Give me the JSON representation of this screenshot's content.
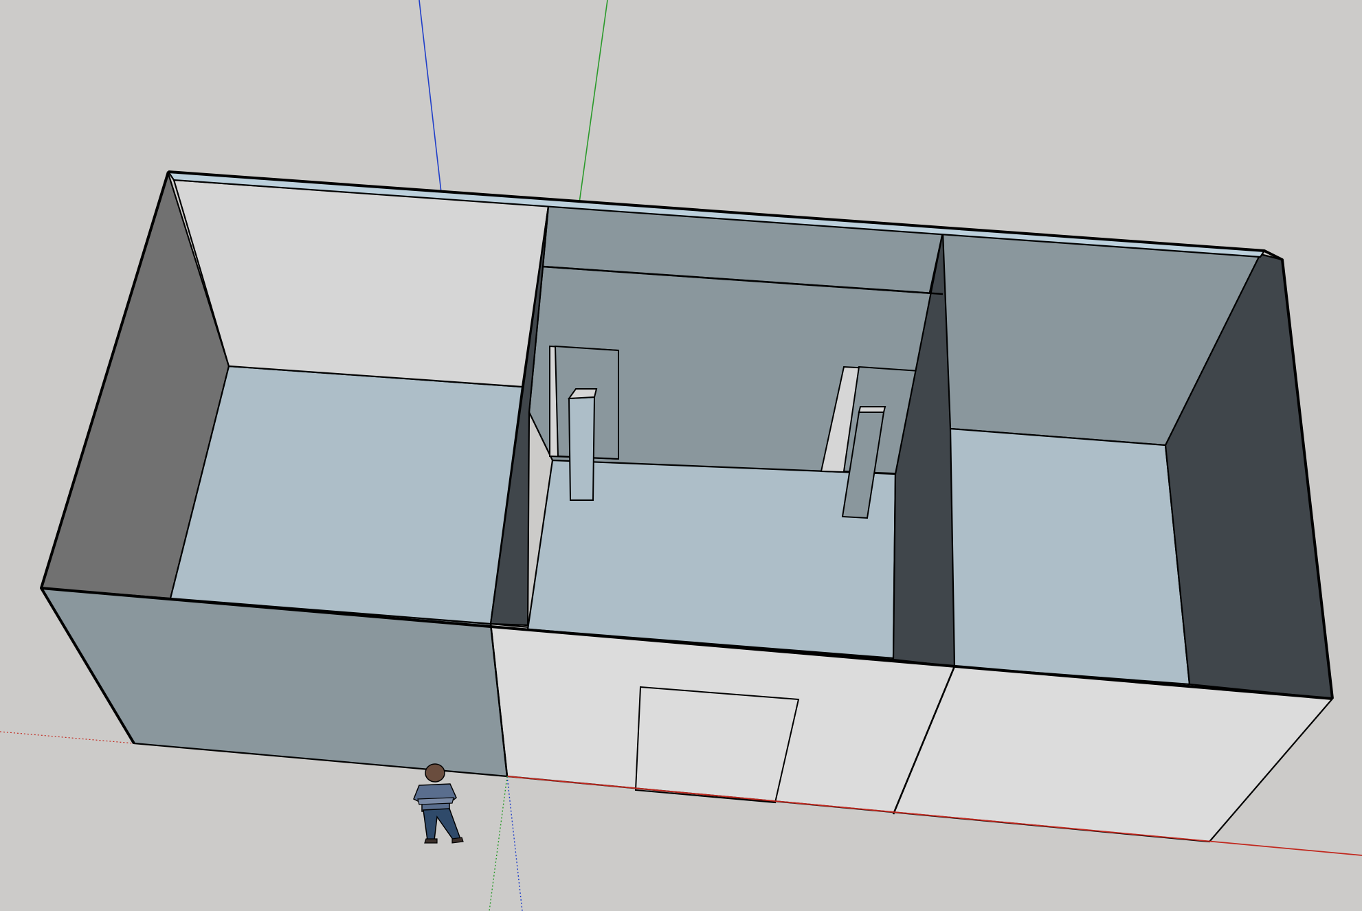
{
  "app": {
    "canvas_background": "#cccbc9"
  },
  "scene": {
    "description_visible_text": "",
    "axes": {
      "red_axis_color": "#c1281e",
      "green_axis_color": "#2a9a2a",
      "blue_axis_color": "#1f3ec9"
    },
    "colors": {
      "floor": "#adbec8",
      "wall_light": "#d6d6d6",
      "wall_mid": "#8a979d",
      "wall_gray": "#717171",
      "wall_dark": "#40464b",
      "exterior_front": "#dcdcdc",
      "exterior_side": "#8a979d",
      "wall_top": "#bcd0dc"
    },
    "entities": [
      "outer-walls",
      "room-left",
      "room-center",
      "room-right",
      "door-front",
      "scale-figure"
    ]
  }
}
